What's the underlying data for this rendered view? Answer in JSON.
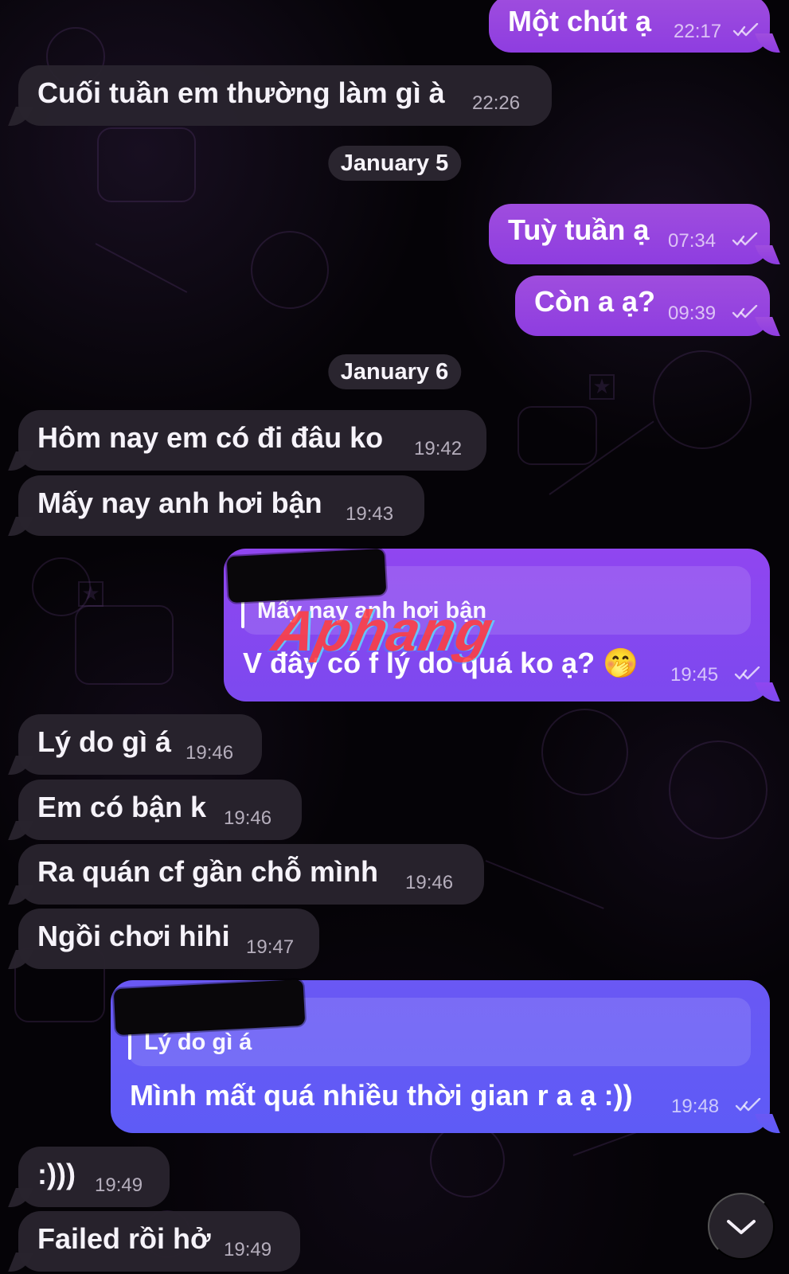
{
  "date_separators": [
    "January 5",
    "January 6"
  ],
  "messages": [
    {
      "text": "Một chút ạ",
      "time": "22:17"
    },
    {
      "text": "Cuối tuần em thường làm gì à",
      "time": "22:26"
    },
    {
      "text": "Tuỳ tuần ạ",
      "time": "07:34"
    },
    {
      "text": "Còn a ạ?",
      "time": "09:39"
    },
    {
      "text": "Hôm nay em có đi đâu ko",
      "time": "19:42"
    },
    {
      "text": "Mấy nay anh hơi bận",
      "time": "19:43"
    },
    {
      "reply": "Mấy nay anh hơi bận",
      "text": "V đây có f lý do quá ko ạ? 🤭",
      "time": "19:45"
    },
    {
      "text": "Lý do gì á",
      "time": "19:46"
    },
    {
      "text": "Em có bận k",
      "time": "19:46"
    },
    {
      "text": "Ra quán cf gần chỗ mình",
      "time": "19:46"
    },
    {
      "text": "Ngồi chơi hihi",
      "time": "19:47"
    },
    {
      "reply": "Lý do gì á",
      "text": "Mình mất quá nhiều thời gian r a ạ :))",
      "time": "19:48"
    },
    {
      "text": ":)))",
      "time": "19:49"
    },
    {
      "text": "Failed rồi hở",
      "time": "19:49"
    }
  ],
  "watermark": "Aphang",
  "scroll_button_icon": "chevron-down-icon",
  "colors": {
    "outgoing": "#9f4dde",
    "reply_outgoing": "#7c49ef",
    "reply_outgoing_alt": "#5e5bf6",
    "incoming": "#29232e",
    "background": "#050307"
  }
}
